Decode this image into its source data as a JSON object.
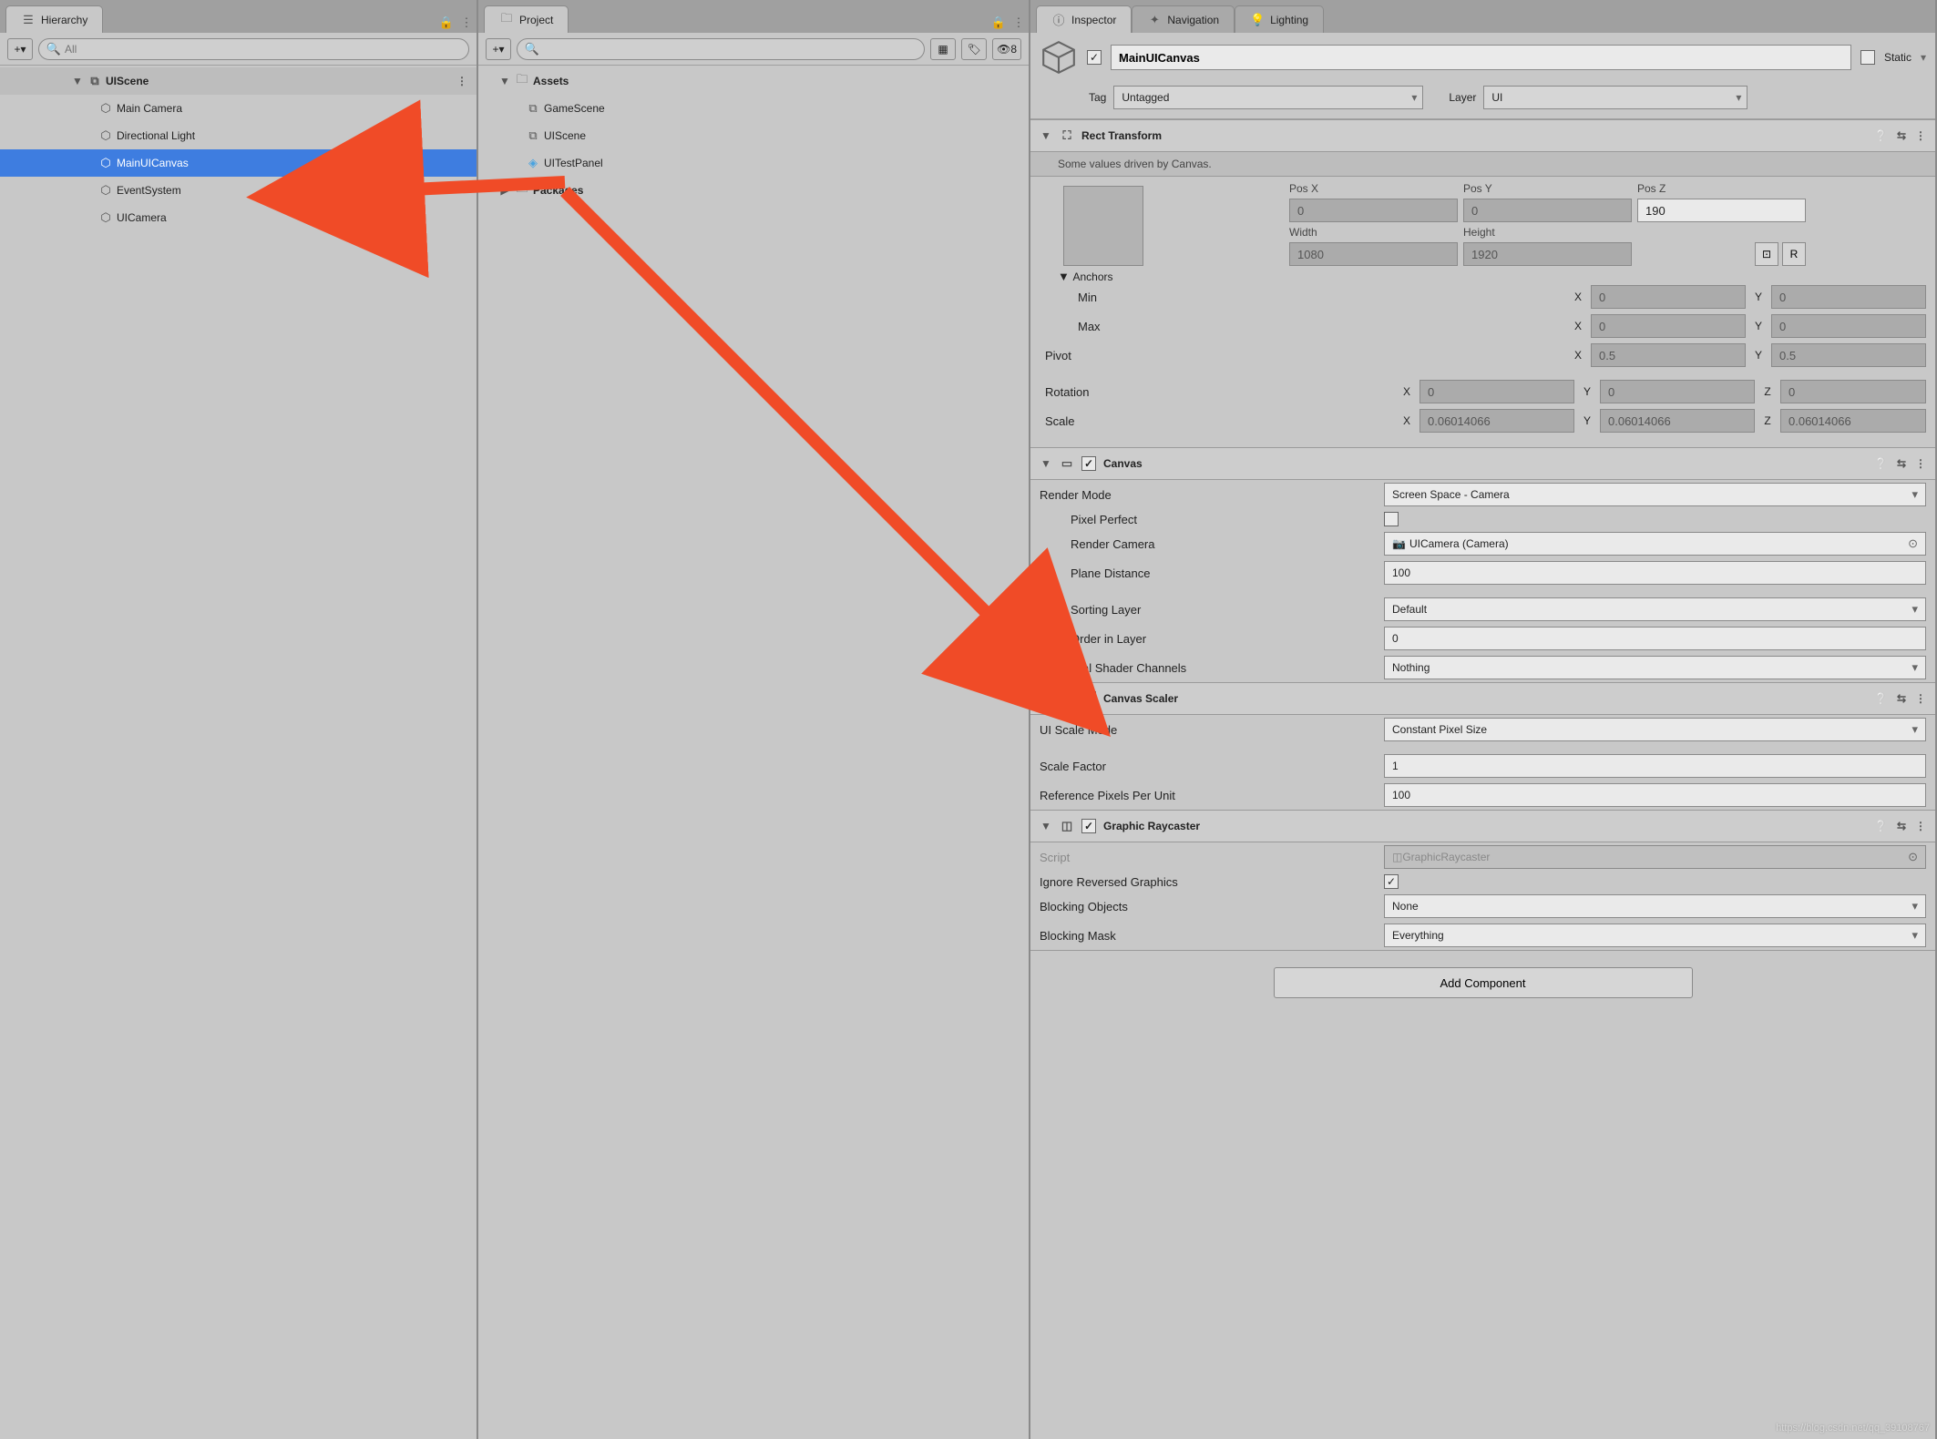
{
  "tabs": {
    "hierarchy": "Hierarchy",
    "project": "Project",
    "inspector": "Inspector",
    "navigation": "Navigation",
    "lighting": "Lighting"
  },
  "hierarchy": {
    "search_placeholder": "All",
    "scene": "UIScene",
    "items": [
      "Main Camera",
      "Directional Light",
      "MainUICanvas",
      "EventSystem",
      "UICamera"
    ]
  },
  "project": {
    "visibility_count": "8",
    "assets_label": "Assets",
    "packages_label": "Packages",
    "items": [
      "GameScene",
      "UIScene",
      "UITestPanel"
    ]
  },
  "inspector": {
    "name": "MainUICanvas",
    "static_label": "Static",
    "tag_label": "Tag",
    "tag_value": "Untagged",
    "layer_label": "Layer",
    "layer_value": "UI",
    "rect_transform": {
      "title": "Rect Transform",
      "notice": "Some values driven by Canvas.",
      "posx_label": "Pos X",
      "posx": "0",
      "posy_label": "Pos Y",
      "posy": "0",
      "posz_label": "Pos Z",
      "posz": "190",
      "width_label": "Width",
      "width": "1080",
      "height_label": "Height",
      "height": "1920",
      "button_r": "R",
      "anchors_label": "Anchors",
      "min_label": "Min",
      "min_x": "0",
      "min_y": "0",
      "max_label": "Max",
      "max_x": "0",
      "max_y": "0",
      "pivot_label": "Pivot",
      "pivot_x": "0.5",
      "pivot_y": "0.5",
      "rotation_label": "Rotation",
      "rot_x": "0",
      "rot_y": "0",
      "rot_z": "0",
      "scale_label": "Scale",
      "scale_x": "0.06014066",
      "scale_y": "0.06014066",
      "scale_z": "0.06014066"
    },
    "canvas": {
      "title": "Canvas",
      "render_mode_label": "Render Mode",
      "render_mode": "Screen Space - Camera",
      "pixel_perfect_label": "Pixel Perfect",
      "render_camera_label": "Render Camera",
      "render_camera": "UICamera (Camera)",
      "plane_distance_label": "Plane Distance",
      "plane_distance": "100",
      "sorting_layer_label": "Sorting Layer",
      "sorting_layer": "Default",
      "order_label": "Order in Layer",
      "order": "0",
      "channels_label": "Additional Shader Channels",
      "channels": "Nothing"
    },
    "scaler": {
      "title": "Canvas Scaler",
      "mode_label": "UI Scale Mode",
      "mode": "Constant Pixel Size",
      "factor_label": "Scale Factor",
      "factor": "1",
      "ref_label": "Reference Pixels Per Unit",
      "ref": "100"
    },
    "raycaster": {
      "title": "Graphic Raycaster",
      "script_label": "Script",
      "script": "GraphicRaycaster",
      "ignore_label": "Ignore Reversed Graphics",
      "blocking_obj_label": "Blocking Objects",
      "blocking_obj": "None",
      "blocking_mask_label": "Blocking Mask",
      "blocking_mask": "Everything"
    },
    "add_component": "Add Component"
  },
  "watermark": "https://blog.csdn.net/qq_39108767"
}
